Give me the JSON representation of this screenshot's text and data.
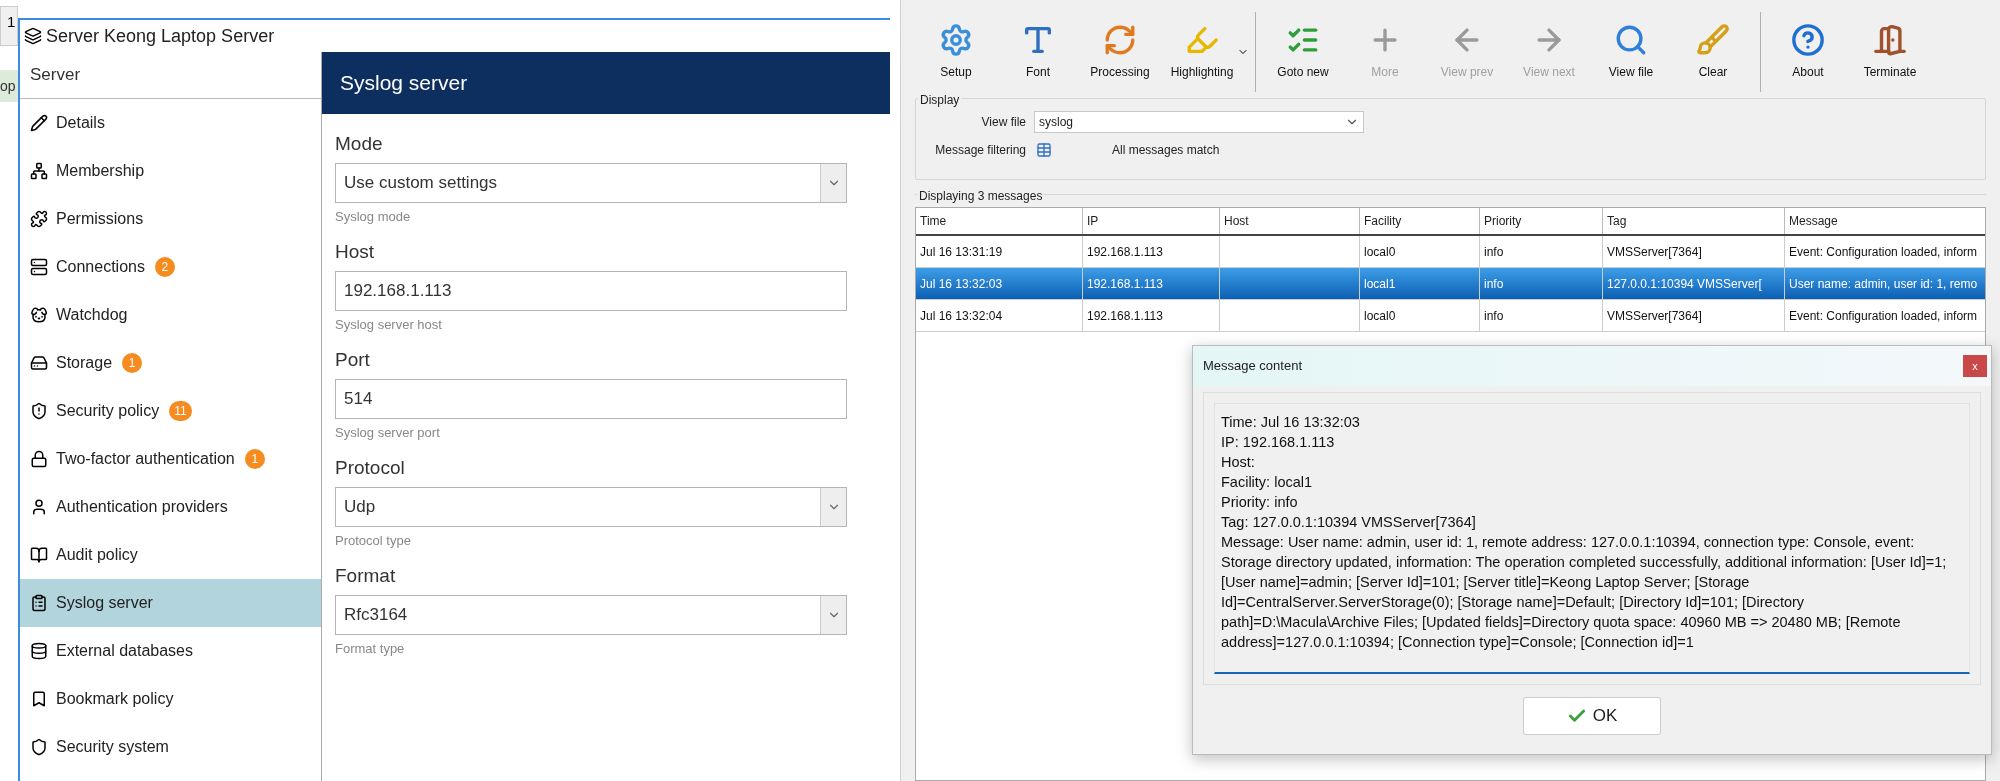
{
  "background_window": {
    "tab": "1",
    "row": "op"
  },
  "server_window": {
    "title": "Server Keong Laptop Server",
    "sidebar": {
      "header": "Server",
      "items": [
        {
          "label": "Details",
          "selected": false
        },
        {
          "label": "Membership",
          "selected": false
        },
        {
          "label": "Permissions",
          "selected": false
        },
        {
          "label": "Connections",
          "badge": "2",
          "selected": false
        },
        {
          "label": "Watchdog",
          "selected": false
        },
        {
          "label": "Storage",
          "badge": "1",
          "selected": false
        },
        {
          "label": "Security policy",
          "badge": "11",
          "selected": false
        },
        {
          "label": "Two-factor authentication",
          "badge": "1",
          "selected": false
        },
        {
          "label": "Authentication providers",
          "selected": false
        },
        {
          "label": "Audit policy",
          "selected": false
        },
        {
          "label": "Syslog server",
          "selected": true
        },
        {
          "label": "External databases",
          "selected": false
        },
        {
          "label": "Bookmark policy",
          "selected": false
        },
        {
          "label": "Security system",
          "selected": false
        }
      ]
    },
    "panel": {
      "title": "Syslog server",
      "fields": [
        {
          "kind": "select",
          "label": "Mode",
          "value": "Use custom settings",
          "hint": "Syslog mode"
        },
        {
          "kind": "input",
          "label": "Host",
          "value": "192.168.1.113",
          "hint": "Syslog server host"
        },
        {
          "kind": "input",
          "label": "Port",
          "value": "514",
          "hint": "Syslog server port"
        },
        {
          "kind": "select",
          "label": "Protocol",
          "value": "Udp",
          "hint": "Protocol type"
        },
        {
          "kind": "select",
          "label": "Format",
          "value": "Rfc3164",
          "hint": "Format type"
        }
      ]
    }
  },
  "viewer": {
    "toolbar_groups": [
      {
        "buttons": [
          {
            "label": "Setup",
            "disabled": false,
            "has_menu": false
          },
          {
            "label": "Font",
            "disabled": false,
            "has_menu": false
          },
          {
            "label": "Processing",
            "disabled": false,
            "has_menu": false
          },
          {
            "label": "Highlighting",
            "disabled": false,
            "has_menu": true
          }
        ]
      },
      {
        "buttons": [
          {
            "label": "Goto new",
            "disabled": false,
            "has_menu": false
          },
          {
            "label": "More",
            "disabled": true,
            "has_menu": false
          },
          {
            "label": "View prev",
            "disabled": true,
            "has_menu": false
          },
          {
            "label": "View next",
            "disabled": true,
            "has_menu": false
          },
          {
            "label": "View file",
            "disabled": false,
            "has_menu": false
          },
          {
            "label": "Clear",
            "disabled": false,
            "has_menu": false
          }
        ]
      },
      {
        "buttons": [
          {
            "label": "About",
            "disabled": false,
            "has_menu": false
          },
          {
            "label": "Terminate",
            "disabled": false,
            "has_menu": false
          }
        ]
      }
    ],
    "display": {
      "title": "Display",
      "view_file_label": "View file",
      "view_file_value": "syslog",
      "filtering_label": "Message filtering",
      "filtering_status": "All messages match"
    },
    "messages": {
      "title": "Displaying 3 messages",
      "columns": [
        "Time",
        "IP",
        "Host",
        "Facility",
        "Priority",
        "Tag",
        "Message"
      ],
      "rows": [
        {
          "cells": [
            "Jul 16 13:31:19",
            "192.168.1.113",
            "",
            "local0",
            "info",
            "VMSServer[7364]",
            "Event: Configuration loaded, inform"
          ],
          "selected": false
        },
        {
          "cells": [
            "Jul 16 13:32:03",
            "192.168.1.113",
            "",
            "local1",
            "info",
            "127.0.0.1:10394 VMSServer[",
            "User name: admin, user id: 1, remo"
          ],
          "selected": true
        },
        {
          "cells": [
            "Jul 16 13:32:04",
            "192.168.1.113",
            "",
            "local0",
            "info",
            "VMSServer[7364]",
            "Event: Configuration loaded, inform"
          ],
          "selected": false
        }
      ]
    }
  },
  "dialog": {
    "title": "Message content",
    "close": "x",
    "lines": [
      "Time: Jul 16 13:32:03",
      "IP: 192.168.1.113",
      "Host:",
      "Facility: local1",
      "Priority: info",
      "Tag: 127.0.0.1:10394 VMSServer[7364]",
      "Message: User name: admin, user id: 1, remote address: 127.0.0.1:10394, connection type: Console, event: Storage directory updated, information: The operation completed successfully, additional information: [User Id]=1; [User name]=admin; [Server Id]=101; [Server title]=Keong Laptop Server; [Storage Id]=CentralServer.ServerStorage(0); [Storage name]=Default; [Directory Id]=101; [Directory path]=D:\\Macula\\Archive Files; [Updated fields]=Directory quota space: 40960 MB => 20480 MB; [Remote address]=127.0.0.1:10394; [Connection type]=Console; [Connection id]=1"
    ],
    "ok": "OK"
  }
}
